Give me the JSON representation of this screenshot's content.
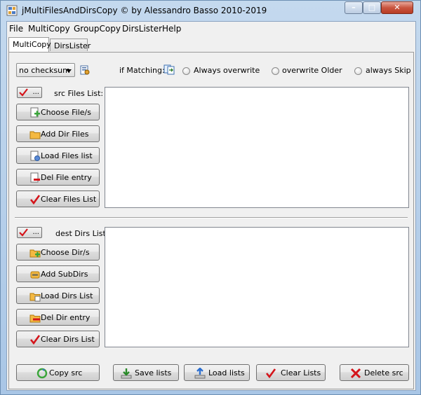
{
  "window": {
    "title": "jMultiFilesAndDirsCopy  © by Alessandro Basso 2010-2019",
    "controls": {
      "minimize": "–",
      "maximize": "□",
      "close": "✕"
    }
  },
  "menu": {
    "items": [
      "File",
      "MultiCopy",
      "GroupCopy",
      "DirsLister",
      "Help"
    ]
  },
  "tabs": [
    "MultiCopy",
    "DirsLister"
  ],
  "checksum_select": {
    "value": "no checksum"
  },
  "matching": {
    "label": "if Matching:",
    "options": [
      "Always overwrite",
      "overwrite Older",
      "always Skip"
    ]
  },
  "src": {
    "list_label": "src Files List:",
    "tool_button": "...",
    "buttons": [
      "Choose File/s",
      "Add Dir Files",
      "Load Files list",
      "Del File entry",
      "Clear Files List"
    ]
  },
  "dest": {
    "list_label": "dest Dirs List:",
    "tool_button": "...",
    "buttons": [
      "Choose Dir/s",
      "Add SubDirs",
      "Load Dirs List",
      "Del Dir entry",
      "Clear Dirs List"
    ]
  },
  "bottom": {
    "buttons": [
      "Copy src",
      "Save lists",
      "Load lists",
      "Clear Lists",
      "Delete src"
    ]
  },
  "colors": {
    "title_bar": "#b9d1ea",
    "close_button": "#c9553f",
    "panel_bg": "#f0f0f0",
    "check_red": "#d4141a"
  }
}
